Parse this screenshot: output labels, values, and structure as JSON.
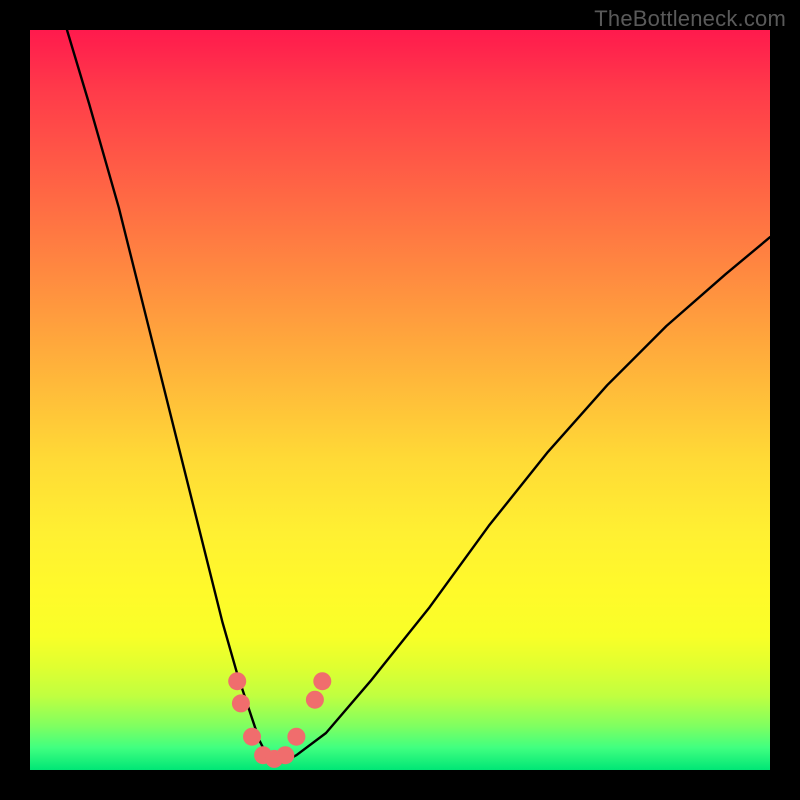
{
  "watermark": "TheBottleneck.com",
  "chart_data": {
    "type": "line",
    "title": "",
    "xlabel": "",
    "ylabel": "",
    "xlim": [
      0,
      100
    ],
    "ylim": [
      0,
      100
    ],
    "series": [
      {
        "name": "bottleneck-curve",
        "x": [
          5,
          8,
          12,
          16,
          20,
          24,
          26,
          28,
          30,
          31,
          32,
          33,
          34,
          36,
          40,
          46,
          54,
          62,
          70,
          78,
          86,
          94,
          100
        ],
        "values": [
          100,
          90,
          76,
          60,
          44,
          28,
          20,
          13,
          7,
          4,
          2,
          1,
          1,
          2,
          5,
          12,
          22,
          33,
          43,
          52,
          60,
          67,
          72
        ]
      }
    ],
    "markers": [
      {
        "name": "left-upper-dot",
        "x": 28.0,
        "y": 12.0
      },
      {
        "name": "left-lower-dot",
        "x": 28.5,
        "y": 9.0
      },
      {
        "name": "left-near-min",
        "x": 30.0,
        "y": 4.5
      },
      {
        "name": "trough-left",
        "x": 31.5,
        "y": 2.0
      },
      {
        "name": "trough-mid",
        "x": 33.0,
        "y": 1.5
      },
      {
        "name": "trough-right",
        "x": 34.5,
        "y": 2.0
      },
      {
        "name": "right-near-min",
        "x": 36.0,
        "y": 4.5
      },
      {
        "name": "right-upper-dot",
        "x": 38.5,
        "y": 9.5
      },
      {
        "name": "right-more-dot",
        "x": 39.5,
        "y": 12.0
      }
    ],
    "colors": {
      "curve_stroke": "#000000",
      "marker_fill": "#f06d6d",
      "gradient_top": "#ff1a4d",
      "gradient_bottom": "#00e676"
    }
  }
}
